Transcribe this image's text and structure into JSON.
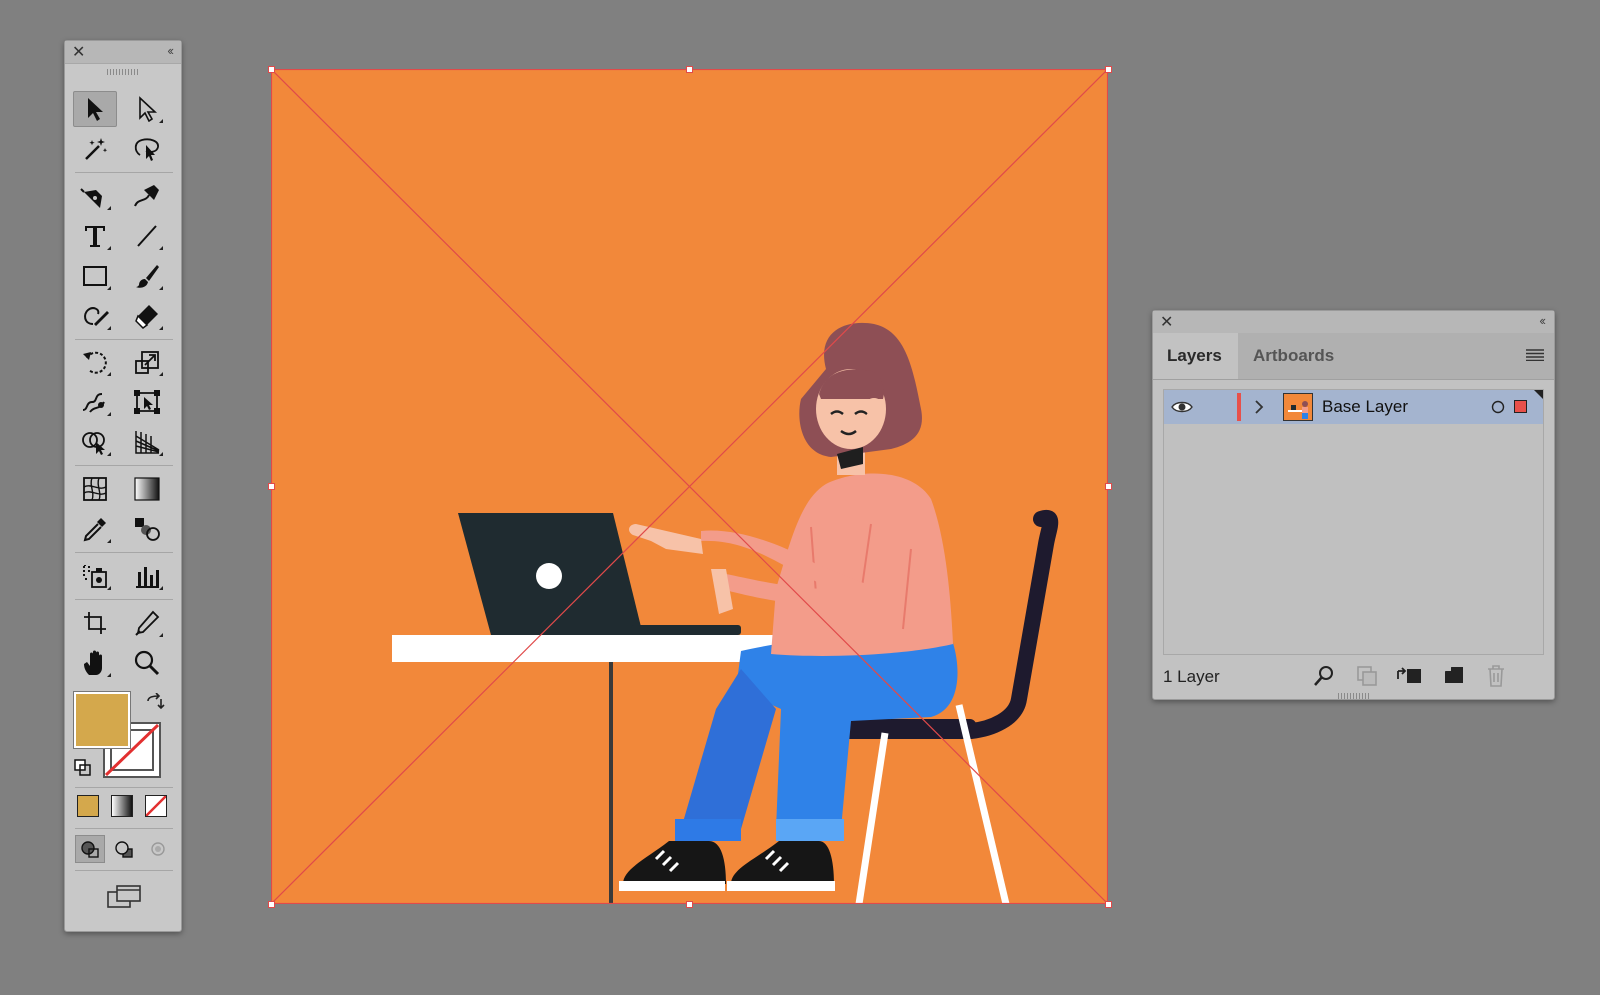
{
  "tools_panel": {
    "close_glyph": "✕",
    "collapse_glyph": "‹‹",
    "fill_color": "#d4a84c",
    "stroke_color": "none"
  },
  "layers_panel": {
    "close_glyph": "✕",
    "collapse_glyph": "‹‹",
    "tabs": [
      {
        "label": "Layers",
        "active": true
      },
      {
        "label": "Artboards",
        "active": false
      }
    ],
    "layers": [
      {
        "name": "Base Layer",
        "visible": true,
        "color": "#e8504a"
      }
    ],
    "count_label": "1 Layer"
  },
  "canvas": {
    "artboard_color": "#f2883a",
    "selection_color": "#e04a4a"
  }
}
